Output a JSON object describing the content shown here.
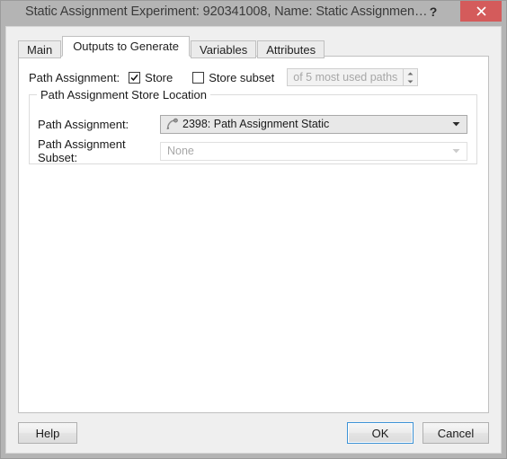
{
  "window": {
    "title": "Static Assignment Experiment: 920341008, Name: Static Assignmen…",
    "help_label": "?",
    "close_label": "close-icon",
    "close_color": "#d45b5b",
    "titlebar_color": "#b4b4b4"
  },
  "tabs": [
    {
      "label": "Main",
      "selected": false
    },
    {
      "label": "Outputs to Generate",
      "selected": true
    },
    {
      "label": "Variables",
      "selected": false
    },
    {
      "label": "Attributes",
      "selected": false
    }
  ],
  "content": {
    "path_assignment_label": "Path Assignment:",
    "store_checkbox": {
      "label": "Store",
      "checked": true
    },
    "store_subset_checkbox": {
      "label": "Store subset",
      "checked": false
    },
    "subset_spinner": {
      "text": "of 5 most used paths",
      "enabled": false,
      "up_icon": "chevron-up-icon",
      "down_icon": "chevron-down-icon"
    },
    "group": {
      "legend": "Path Assignment Store Location",
      "rows": [
        {
          "label": "Path Assignment:",
          "value": "2398: Path Assignment Static",
          "icon": "path-curve-icon",
          "enabled": true,
          "arrow_icon": "chevron-down-icon"
        },
        {
          "label": "Path Assignment Subset:",
          "value": "None",
          "icon": "",
          "enabled": false,
          "arrow_icon": "chevron-down-icon"
        }
      ]
    }
  },
  "footer": {
    "help": "Help",
    "ok": "OK",
    "cancel": "Cancel",
    "focus_color": "#3c92d6"
  }
}
